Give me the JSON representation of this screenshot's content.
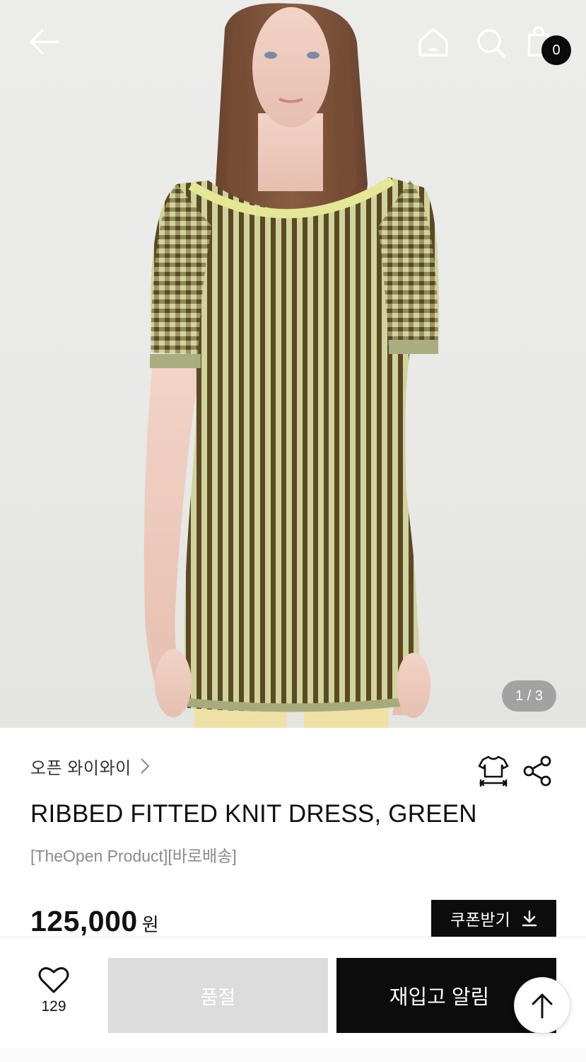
{
  "header": {
    "back_icon": "arrow-left-icon",
    "home_icon": "home-icon",
    "search_icon": "search-icon",
    "cart_icon": "shopping-bag-icon",
    "cart_count": "0"
  },
  "gallery": {
    "indicator": "1 / 3"
  },
  "product": {
    "brand": "오픈 와이와이",
    "title": "RIBBED FITTED KNIT DRESS, GREEN",
    "subtitle": "[TheOpen Product][바로배송]",
    "price": "125,000",
    "currency": "원",
    "coupon_label": "쿠폰받기",
    "size_icon": "size-guide-icon",
    "share_icon": "share-icon"
  },
  "actions": {
    "wish_icon": "heart-icon",
    "wish_count": "129",
    "soldout_label": "품절",
    "restock_label": "재입고 알림",
    "scroll_top_icon": "arrow-up-icon"
  },
  "colors": {
    "accent": "#0c0c0c",
    "soldout_bg": "#dcdcdc",
    "dress_light": "#c9cf93",
    "dress_dark": "#5a4624",
    "trim": "#e6ea9a"
  }
}
